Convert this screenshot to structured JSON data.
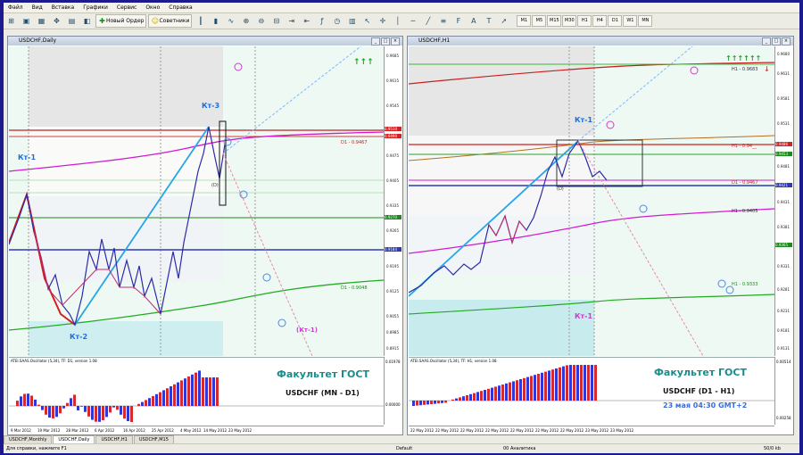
{
  "menu": [
    "Файл",
    "Вид",
    "Вставка",
    "Графики",
    "Сервис",
    "Окно",
    "Справка"
  ],
  "toolbar": {
    "new_order": "Новый Ордер",
    "advisors": "Советники",
    "timeframes": [
      "M1",
      "M5",
      "M15",
      "M30",
      "H1",
      "H4",
      "D1",
      "W1",
      "MN"
    ]
  },
  "left_window": {
    "title": "USDCHF,Daily",
    "osc_label": "ATEI.SAAS.Oscillator (5,34), TF: D1, version 1.08",
    "labels": {
      "kt1": "Кт-1",
      "kt2": "Кт-2",
      "kt3": "Кт-3",
      "kt1p": "(Кт-1)",
      "d": "(D)"
    },
    "brand": "Факультет ГОСТ",
    "pair": "USDCHF (MN - D1)",
    "level_tags": {
      "d1_upper": "D1 - 0.9467",
      "d1_lower": "D1 - 0.9048"
    },
    "price_ticks": [
      "0.9685",
      "0.9615",
      "0.9545",
      "0.9475",
      "0.9405",
      "0.9335",
      "0.9265",
      "0.9195",
      "0.9125",
      "0.9055",
      "0.8985",
      "0.8915"
    ],
    "price_tags": [
      "0.9510",
      "0.9490",
      "0.9270",
      "0.9184"
    ],
    "osc_ticks": [
      "0.01978",
      "0.00000"
    ],
    "dates": [
      "9 Mar 2012",
      "19 Mar 2012",
      "28 Mar 2012",
      "6 Apr 2012",
      "16 Apr 2012",
      "25 Apr 2012",
      "4 May 2012",
      "14 May 2012",
      "23 May 2012"
    ]
  },
  "right_window": {
    "title": "USDCHF,H1",
    "osc_label": "ATEI.SAAS.Oscillator (5,34), TF: H1, version 1.08",
    "labels": {
      "kt1_top": "Кт-1",
      "kt1_bottom": "Кт-1",
      "d": "(D)"
    },
    "brand": "Факультет ГОСТ",
    "pair": "USDCHF (D1 - H1)",
    "time_note": "23 мая 04:30 GMT+2",
    "level_tags": {
      "h1_top": "H1 - 0.9683",
      "h1_a": "H1 - 0.94__",
      "d1": "D1 - 0.9467",
      "h1_b": "H1 - 0.9405",
      "h1_c": "H1 - 0.9333"
    },
    "price_ticks": [
      "0.9680",
      "0.9631",
      "0.9581",
      "0.9531",
      "0.9481",
      "0.9431",
      "0.9381",
      "0.9331",
      "0.9281",
      "0.9231",
      "0.9181",
      "0.9131"
    ],
    "price_tags": [
      "0.9486",
      "0.9453",
      "0.9421",
      "0.9365"
    ],
    "osc_ticks": [
      "0.00514",
      "0.00258"
    ],
    "dates": [
      "22 May 2012",
      "22 May 2012",
      "22 May 2012",
      "22 May 2012",
      "22 May 2012",
      "22 May 2012",
      "22 May 2012",
      "23 May 2012",
      "23 May 2012"
    ]
  },
  "tabs": [
    "USDCHF,Monthly",
    "USDCHF,Daily",
    "USDCHF,H1",
    "USDCHF,M15"
  ],
  "status": {
    "help": "Для справки, нажмите F1",
    "profile": "Default",
    "bars": "00 Аналитика",
    "traffic": "50/0 kb"
  },
  "colors": {
    "buy_arrows": "#1aa61a",
    "sell_arrows": "#e23a1a",
    "brand": "#1a8c8c",
    "time_note": "#3a6ed8"
  }
}
